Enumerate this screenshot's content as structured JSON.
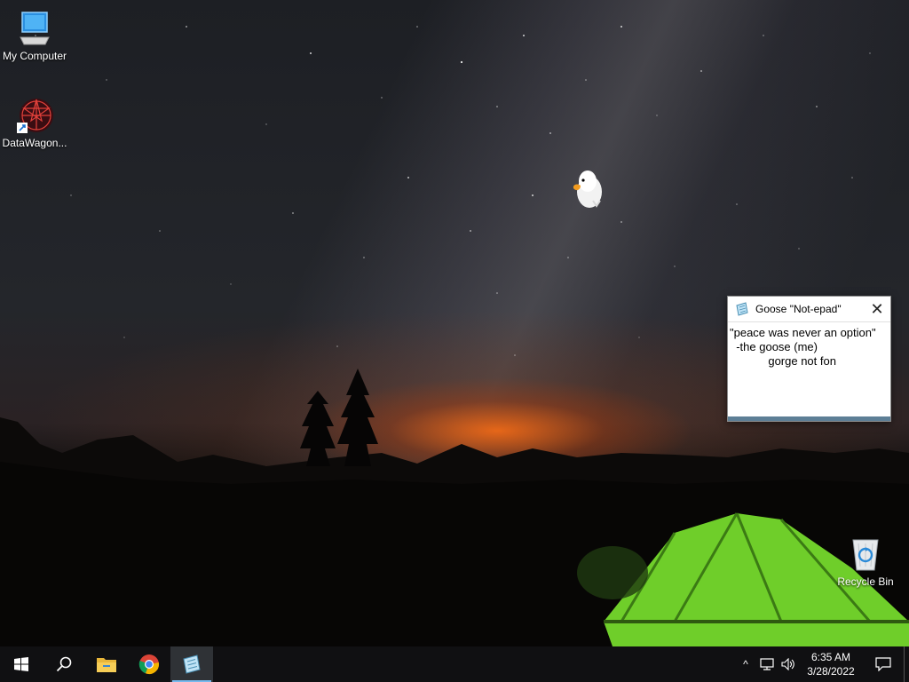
{
  "desktop": {
    "icons": [
      {
        "label": "My Computer",
        "icon": "computer-icon"
      },
      {
        "label": "DataWagon...",
        "icon": "datawagon-shortcut-icon"
      },
      {
        "label": "Recycle Bin",
        "icon": "recycle-bin-icon"
      }
    ]
  },
  "notepad": {
    "title": "Goose \"Not-epad\"",
    "close_label": "✕",
    "content": "\"peace was never an option\"\n  -the goose (me)\n            gorge not fon"
  },
  "taskbar": {
    "buttons": [
      "start-icon",
      "search-icon",
      "file-explorer-icon",
      "chrome-icon",
      "notepad-icon"
    ],
    "tray": {
      "chevron": "^",
      "time": "6:35 AM",
      "date": "3/28/2022"
    }
  },
  "colors": {
    "accent": "#76b9ed",
    "taskbar": "#101012",
    "notepad_bar": "#5d7f96"
  }
}
